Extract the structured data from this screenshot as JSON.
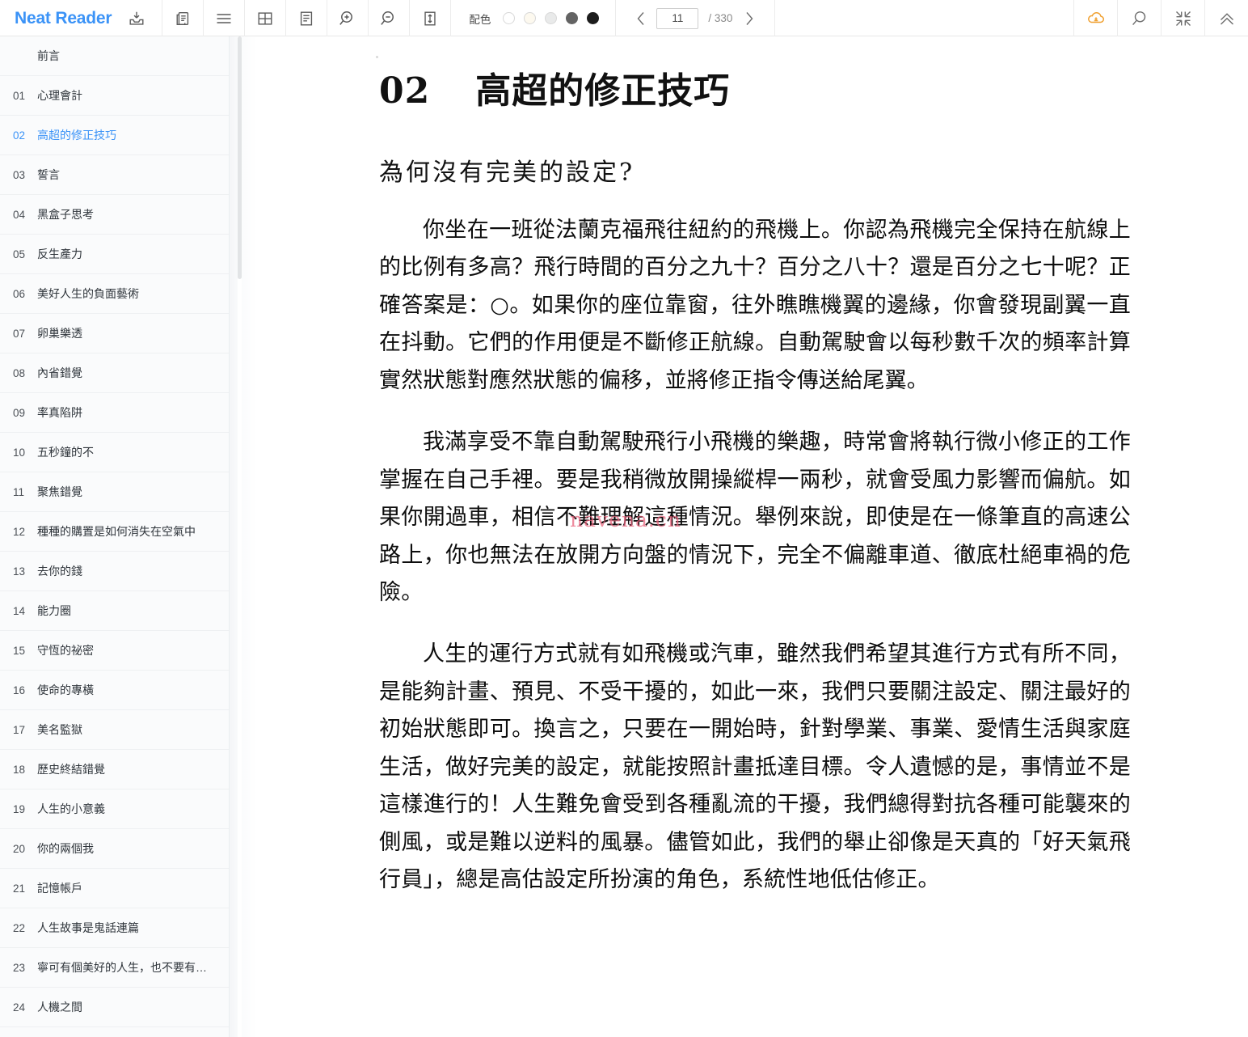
{
  "toolbar": {
    "brand": "Neat Reader",
    "icons": [
      {
        "name": "download-icon",
        "title": "下載"
      },
      {
        "name": "copy-icon",
        "title": "複製"
      },
      {
        "name": "menu-icon",
        "title": "目錄"
      },
      {
        "name": "grid-icon",
        "title": "網格"
      },
      {
        "name": "notes-icon",
        "title": "筆記"
      },
      {
        "name": "zoom-in-icon",
        "title": "放大"
      },
      {
        "name": "zoom-out-icon",
        "title": "縮小"
      },
      {
        "name": "line-height-icon",
        "title": "行距"
      }
    ],
    "color_scheme": {
      "label": "配色",
      "swatches": [
        "#ffffff",
        "#fdf9ef",
        "#e9eaea",
        "#636363",
        "#1c1c1c"
      ],
      "selected_index": 0
    },
    "pager": {
      "prev_label": "‹",
      "next_label": "›",
      "current_page": "11",
      "separator": "/ 330",
      "total_pages": "330"
    },
    "right_icons": [
      {
        "name": "cloud-sync-icon",
        "title": "雲端同步",
        "color": "#f0a030"
      },
      {
        "name": "search-icon",
        "title": "搜尋"
      },
      {
        "name": "collapse-icon",
        "title": "收合"
      },
      {
        "name": "chevron-double-up-icon",
        "title": "回到頂端"
      }
    ]
  },
  "sidebar": {
    "items": [
      {
        "num": "",
        "label": "前言",
        "active": false
      },
      {
        "num": "01",
        "label": "心理會計",
        "active": false
      },
      {
        "num": "02",
        "label": "高超的修正技巧",
        "active": true
      },
      {
        "num": "03",
        "label": "誓言",
        "active": false
      },
      {
        "num": "04",
        "label": "黑盒子思考",
        "active": false
      },
      {
        "num": "05",
        "label": "反生產力",
        "active": false
      },
      {
        "num": "06",
        "label": "美好人生的負面藝術",
        "active": false
      },
      {
        "num": "07",
        "label": "卵巢樂透",
        "active": false
      },
      {
        "num": "08",
        "label": "內省錯覺",
        "active": false
      },
      {
        "num": "09",
        "label": "率真陷阱",
        "active": false
      },
      {
        "num": "10",
        "label": "五秒鐘的不",
        "active": false
      },
      {
        "num": "11",
        "label": "聚焦錯覺",
        "active": false
      },
      {
        "num": "12",
        "label": "種種的購置是如何消失在空氣中",
        "active": false
      },
      {
        "num": "13",
        "label": "去你的錢",
        "active": false
      },
      {
        "num": "14",
        "label": "能力圈",
        "active": false
      },
      {
        "num": "15",
        "label": "守恆的祕密",
        "active": false
      },
      {
        "num": "16",
        "label": "使命的專橫",
        "active": false
      },
      {
        "num": "17",
        "label": "美名監獄",
        "active": false
      },
      {
        "num": "18",
        "label": "歷史終結錯覺",
        "active": false
      },
      {
        "num": "19",
        "label": "人生的小意義",
        "active": false
      },
      {
        "num": "20",
        "label": "你的兩個我",
        "active": false
      },
      {
        "num": "21",
        "label": "記憶帳戶",
        "active": false
      },
      {
        "num": "22",
        "label": "人生故事是鬼話連篇",
        "active": false
      },
      {
        "num": "23",
        "label": "寧可有個美好的人生，也不要有…",
        "active": false
      },
      {
        "num": "24",
        "label": "人機之間",
        "active": false
      }
    ]
  },
  "content": {
    "chapter_number": "02",
    "chapter_title": "高超的修正技巧",
    "section_title": "為何沒有完美的設定?",
    "watermark": "navena.cn",
    "paragraphs": [
      "你坐在一班從法蘭克福飛往紐約的飛機上。你認為飛機完全保持在航線上的比例有多高？飛行時間的百分之九十？百分之八十？還是百分之七十呢？正確答案是：○。如果你的座位靠窗，往外瞧瞧機翼的邊緣，你會發現副翼一直在抖動。它們的作用便是不斷修正航線。自動駕駛會以每秒數千次的頻率計算實然狀態對應然狀態的偏移，並將修正指令傳送給尾翼。",
      "我滿享受不靠自動駕駛飛行小飛機的樂趣，時常會將執行微小修正的工作掌握在自己手裡。要是我稍微放開操縱桿一兩秒，就會受風力影響而偏航。如果你開過車，相信不難理解這種情況。舉例來說，即使是在一條筆直的高速公路上，你也無法在放開方向盤的情況下，完全不偏離車道、徹底杜絕車禍的危險。",
      "人生的運行方式就有如飛機或汽車，雖然我們希望其進行方式有所不同，是能夠計畫、預見、不受干擾的，如此一來，我們只要關注設定、關注最好的初始狀態即可。換言之，只要在一開始時，針對學業、事業、愛情生活與家庭生活，做好完美的設定，就能按照計畫抵達目標。令人遺憾的是，事情並不是這樣進行的！人生難免會受到各種亂流的干擾，我們總得對抗各種可能襲來的側風，或是難以逆料的風暴。儘管如此，我們的舉止卻像是天真的「好天氣飛行員」，總是高估設定所扮演的角色，系統性地低估修正。"
    ]
  }
}
